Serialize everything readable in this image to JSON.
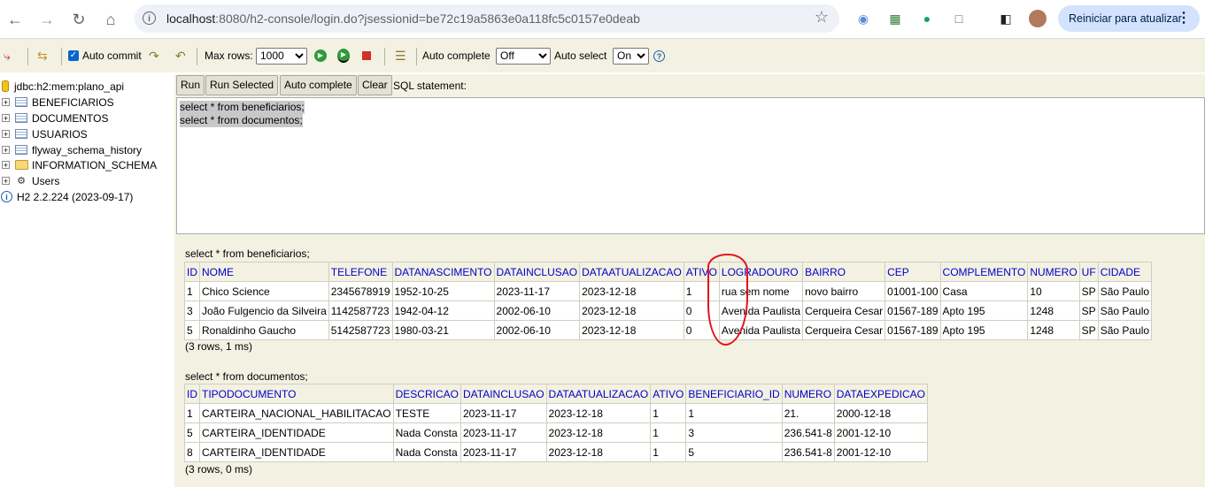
{
  "browser": {
    "url_host": "localhost",
    "url_rest": ":8080/h2-console/login.do?jsessionid=be72c19a5863e0a118fc5c0157e0deab",
    "update_button": "Reiniciar para atualizar"
  },
  "toolbar": {
    "auto_commit": "Auto commit",
    "max_rows_label": "Max rows:",
    "max_rows_value": "1000",
    "auto_complete_label": "Auto complete",
    "auto_complete_value": "Off",
    "auto_select_label": "Auto select",
    "auto_select_value": "On"
  },
  "tree": {
    "connection": "jdbc:h2:mem:plano_api",
    "items": [
      "BENEFICIARIOS",
      "DOCUMENTOS",
      "USUARIOS",
      "flyway_schema_history",
      "INFORMATION_SCHEMA",
      "Users"
    ],
    "version": "H2 2.2.224 (2023-09-17)"
  },
  "buttons": {
    "run": "Run",
    "run_selected": "Run Selected",
    "auto_complete": "Auto complete",
    "clear": "Clear",
    "sql_label": "SQL statement:"
  },
  "sql": {
    "lines": [
      "select * from beneficiarios;",
      "select * from documentos;"
    ]
  },
  "result1": {
    "query": "select * from beneficiarios;",
    "columns": [
      "ID",
      "NOME",
      "TELEFONE",
      "DATANASCIMENTO",
      "DATAINCLUSAO",
      "DATAATUALIZACAO",
      "ATIVO",
      "LOGRADOURO",
      "BAIRRO",
      "CEP",
      "COMPLEMENTO",
      "NUMERO",
      "UF",
      "CIDADE"
    ],
    "rows": [
      [
        "1",
        "Chico Science",
        "2345678919",
        "1952-10-25",
        "2023-11-17",
        "2023-12-18",
        "1",
        "rua sem nome",
        "novo bairro",
        "01001-100",
        "Casa",
        "10",
        "SP",
        "São Paulo"
      ],
      [
        "3",
        "João Fulgencio da Silveira",
        "1142587723",
        "1942-04-12",
        "2002-06-10",
        "2023-12-18",
        "0",
        "Avenida Paulista",
        "Cerqueira Cesar",
        "01567-189",
        "Apto 195",
        "1248",
        "SP",
        "São Paulo"
      ],
      [
        "5",
        "Ronaldinho Gaucho",
        "5142587723",
        "1980-03-21",
        "2002-06-10",
        "2023-12-18",
        "0",
        "Avenida Paulista",
        "Cerqueira Cesar",
        "01567-189",
        "Apto 195",
        "1248",
        "SP",
        "São Paulo"
      ]
    ],
    "count": "(3 rows, 1 ms)"
  },
  "result2": {
    "query": "select * from documentos;",
    "columns": [
      "ID",
      "TIPODOCUMENTO",
      "DESCRICAO",
      "DATAINCLUSAO",
      "DATAATUALIZACAO",
      "ATIVO",
      "BENEFICIARIO_ID",
      "NUMERO",
      "DATAEXPEDICAO"
    ],
    "rows": [
      [
        "1",
        "CARTEIRA_NACIONAL_HABILITACAO",
        "TESTE",
        "2023-11-17",
        "2023-12-18",
        "1",
        "1",
        "21.",
        "2000-12-18"
      ],
      [
        "5",
        "CARTEIRA_IDENTIDADE",
        "Nada Consta",
        "2023-11-17",
        "2023-12-18",
        "1",
        "3",
        "236.541-8",
        "2001-12-10"
      ],
      [
        "8",
        "CARTEIRA_IDENTIDADE",
        "Nada Consta",
        "2023-11-17",
        "2023-12-18",
        "1",
        "5",
        "236.541-8",
        "2001-12-10"
      ]
    ],
    "count": "(3 rows, 0 ms)"
  }
}
